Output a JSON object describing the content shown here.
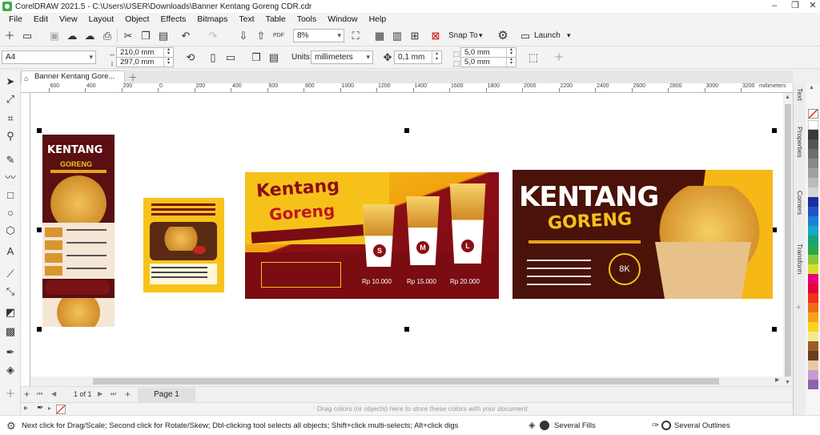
{
  "app": {
    "title": "CorelDRAW 2021.5 - C:\\Users\\USER\\Downloads\\Banner Kentang Goreng CDR.cdr",
    "brand_color": "#3fae49"
  },
  "menu": [
    "File",
    "Edit",
    "View",
    "Layout",
    "Object",
    "Effects",
    "Bitmaps",
    "Text",
    "Table",
    "Tools",
    "Window",
    "Help"
  ],
  "toolbar": {
    "zoom": "8%",
    "snap_to": "Snap To",
    "launch": "Launch",
    "pdf": "PDF"
  },
  "propbar": {
    "page_size": "A4",
    "width": "210,0 mm",
    "height": "297,0 mm",
    "units_label": "Units:",
    "units": "millimeters",
    "nudge": "0,1 mm",
    "dup_x": "5,0 mm",
    "dup_y": "5,0 mm"
  },
  "document": {
    "tab": "Banner Kentang Gore..."
  },
  "ruler": {
    "ticks": [
      "800",
      "600",
      "400",
      "200",
      "0",
      "200",
      "400",
      "600",
      "800",
      "1000",
      "1200",
      "1400",
      "1600",
      "1800",
      "2000",
      "2200",
      "2400",
      "2600",
      "2800",
      "3000",
      "3200"
    ],
    "unit": "millimeters"
  },
  "artwork": {
    "title1": "KENTANG",
    "title2": "GORENG",
    "banner_title1": "Kentang",
    "banner_title2": "Goreng",
    "sizes": [
      "S",
      "M",
      "L"
    ],
    "prices": [
      "Rp 10.000",
      "Rp 15.000",
      "Rp 20.000"
    ],
    "badge": "8K"
  },
  "pagenav": {
    "counter": "1 of 1",
    "page_tab": "Page 1"
  },
  "colorbar": {
    "hint": "Drag colors (or objects) here to store these colors with your document"
  },
  "status": {
    "hint": "Next click for Drag/Scale; Second click for Rotate/Skew; Dbl-clicking tool selects all objects; Shift+click multi-selects; Alt+click digs",
    "fill": "Several Fills",
    "outline": "Several Outlines"
  },
  "dockers": [
    "Text",
    "Properties",
    "Corners",
    "Transform"
  ],
  "palette": [
    "#ffffff",
    "#3a3a3a",
    "#555555",
    "#6e6e6e",
    "#888888",
    "#a1a1a1",
    "#bbbbbb",
    "#d4d4d4",
    "#1a2ea0",
    "#2154c8",
    "#1c7fd8",
    "#18a6c9",
    "#15a27a",
    "#27a844",
    "#8bc53f",
    "#d4df2a",
    "#e6007e",
    "#e4003a",
    "#f0301a",
    "#f06a17",
    "#f7a21b",
    "#fbd31c",
    "#f4e98a",
    "#9c5b2b",
    "#6b3d1c",
    "#e8c9a3",
    "#c79bd0",
    "#8c62aa"
  ]
}
